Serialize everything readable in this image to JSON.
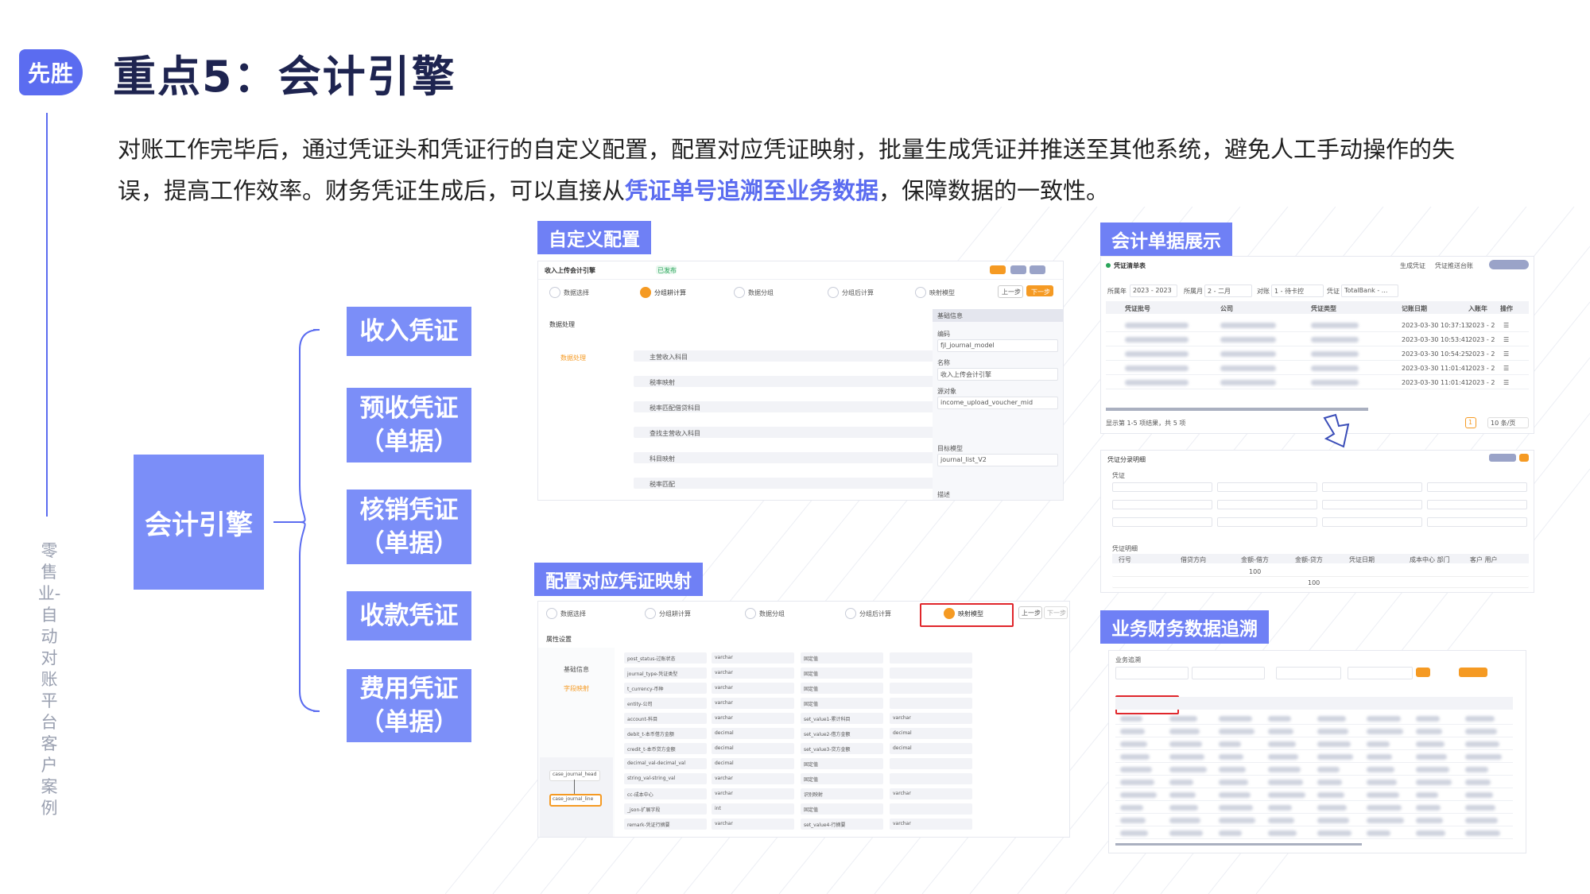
{
  "header": {
    "badge": "先胜",
    "title": "重点5：会计引擎",
    "side_tag": "零售业-自动对账平台 客户案例"
  },
  "description": {
    "part1": "对账工作完毕后，通过凭证头和凭证行的自定义配置，配置对应凭证映射，批量生成凭证并推送至其他系统，避免人工手动操作的失误，提高工作效率。财务凭证生成后，可以直接从",
    "highlight": "凭证单号追溯至业务数据",
    "part2": "，保障数据的一致性。"
  },
  "mindmap": {
    "root": "会计引擎",
    "branches": [
      {
        "line1": "收入凭证",
        "line2": ""
      },
      {
        "line1": "预收凭证",
        "line2": "（单据）"
      },
      {
        "line1": "核销凭证",
        "line2": "（单据）"
      },
      {
        "line1": "收款凭证",
        "line2": ""
      },
      {
        "line1": "费用凭证",
        "line2": "（单据）"
      }
    ]
  },
  "sections": {
    "custom_config": "自定义配置",
    "voucher_mapping": "配置对应凭证映射",
    "accounting_docs": "会计单据展示",
    "trace": "业务财务数据追溯"
  },
  "shot_config": {
    "title": "收入上传会计引擎",
    "status": "已发布",
    "steps": [
      "数据选择",
      "分组耕计算",
      "数据分组",
      "分组后计算",
      "映射模型"
    ],
    "prev": "上一步",
    "next": "下一步",
    "tree_head": "数据处理",
    "tree_node": "数据处理",
    "rules": [
      "主营收入科目",
      "税率映射",
      "税率匹配借贷科目",
      "查找主营收入科目",
      "科目映射",
      "税率匹配"
    ],
    "panel_title": "基础信息",
    "panel_fields": [
      {
        "label": "编码",
        "value": "fjl_journal_model"
      },
      {
        "label": "名称",
        "value": "收入上传会计引擎"
      },
      {
        "label": "源对象",
        "value": "income_upload_voucher_mid"
      },
      {
        "label": "目标模型",
        "value": "journal_list_V2"
      }
    ],
    "panel_desc": "描述"
  },
  "shot_mapping": {
    "steps": [
      "数据选择",
      "分组耕计算",
      "数据分组",
      "分组后计算",
      "映射模型"
    ],
    "prev": "上一步",
    "next": "下一步",
    "section": "属性设置",
    "left_items": [
      "基础信息",
      "字段映射"
    ],
    "nodes": [
      "case_journal_head",
      "case_journal_line"
    ],
    "rows": [
      {
        "field": "post_status-过账状态",
        "type": "varchar",
        "rule": "固定值",
        "extra": ""
      },
      {
        "field": "journal_type-凭证类型",
        "type": "varchar",
        "rule": "固定值",
        "extra": ""
      },
      {
        "field": "t_currency-币种",
        "type": "varchar",
        "rule": "固定值",
        "extra": ""
      },
      {
        "field": "entity-公司",
        "type": "varchar",
        "rule": "固定值",
        "extra": ""
      },
      {
        "field": "account-科目",
        "type": "varchar",
        "rule": "set_value1-累计科目",
        "extra": "varchar"
      },
      {
        "field": "debit_t-本币借方金额",
        "type": "decimal",
        "rule": "set_value2-借方金额",
        "extra": "decimal"
      },
      {
        "field": "credit_t-本币贷方金额",
        "type": "decimal",
        "rule": "set_value3-贷方金额",
        "extra": "decimal"
      },
      {
        "field": "decimal_val-decimal_val",
        "type": "decimal",
        "rule": "固定值",
        "extra": ""
      },
      {
        "field": "string_val-string_val",
        "type": "varchar",
        "rule": "固定值",
        "extra": ""
      },
      {
        "field": "cc-成本中心",
        "type": "varchar",
        "rule": "识别映射",
        "extra": "varchar"
      },
      {
        "field": "_json-扩展字段",
        "type": "int",
        "rule": "固定值",
        "extra": ""
      },
      {
        "field": "remark-凭证行摘要",
        "type": "varchar",
        "rule": "set_value4-行摘要",
        "extra": "varchar"
      }
    ]
  },
  "shot_docs": {
    "title": "凭证清单表",
    "actions": [
      "生成凭证",
      "凭证推送台账"
    ],
    "filters": [
      "所属年",
      "2023 - 2023",
      "所属月",
      "2 - 二月",
      "对账",
      "1 - 待卡控",
      "凭证",
      "TotalBank - ..."
    ],
    "columns": [
      "凭证批号",
      "公司",
      "凭证类型",
      "记账日期",
      "入账年",
      "操作"
    ],
    "dates": [
      "2023-03-30 10:37:13",
      "2023-03-30 10:53:41",
      "2023-03-30 10:54:25",
      "2023-03-30 11:01:41",
      "2023-03-30 11:01:41"
    ],
    "year_col": "2023 - 2",
    "footer": "显示第 1-5 项结果，共 5 项",
    "page": "1",
    "page_size": "10 条/页",
    "detail_title": "凭证分录明细",
    "detail_sections": [
      "凭证",
      "凭证明细"
    ],
    "detail_cols": [
      "行号",
      "借贷方向",
      "金额-借方",
      "金额-贷方",
      "凭证日期",
      "成本中心 部门",
      "客户 用户"
    ],
    "amounts": [
      "100",
      "100"
    ]
  },
  "shot_trace": {
    "breadcrumb": "业务追溯"
  }
}
